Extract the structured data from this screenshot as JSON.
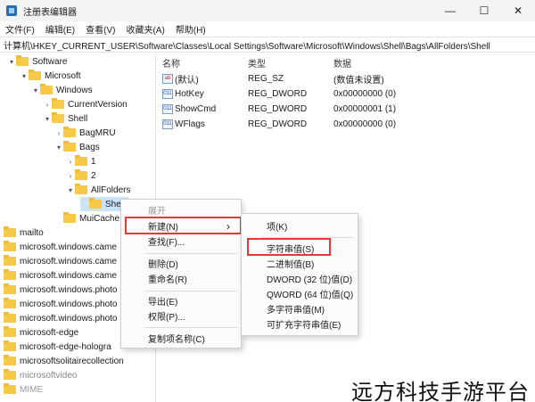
{
  "window": {
    "title": "注册表编辑器",
    "minimize": "—",
    "maximize": "☐",
    "close": "✕"
  },
  "menu": [
    "文件(F)",
    "编辑(E)",
    "查看(V)",
    "收藏夹(A)",
    "帮助(H)"
  ],
  "address": "计算机\\HKEY_CURRENT_USER\\Software\\Classes\\Local Settings\\Software\\Microsoft\\Windows\\Shell\\Bags\\AllFolders\\Shell",
  "tree": [
    {
      "label": "Software",
      "chevron": "▾"
    },
    {
      "label": "Microsoft",
      "chevron": "▾"
    },
    {
      "label": "Windows",
      "chevron": "▾"
    },
    {
      "label": "CurrentVersion",
      "chevron": "›"
    },
    {
      "label": "Shell",
      "chevron": "▾"
    },
    {
      "label": "BagMRU",
      "chevron": "›"
    },
    {
      "label": "Bags",
      "chevron": "▾"
    },
    {
      "label": "1",
      "chevron": "›"
    },
    {
      "label": "2",
      "chevron": "›"
    },
    {
      "label": "AllFolders",
      "chevron": "▾"
    },
    {
      "label": "Shell",
      "chevron": ""
    },
    {
      "label": "MuiCache",
      "chevron": ""
    },
    {
      "label": "mailto",
      "chevron": ""
    },
    {
      "label": "microsoft.windows.came",
      "chevron": ""
    },
    {
      "label": "microsoft.windows.came",
      "chevron": ""
    },
    {
      "label": "microsoft.windows.came",
      "chevron": ""
    },
    {
      "label": "microsoft.windows.photo",
      "chevron": ""
    },
    {
      "label": "microsoft.windows.photo",
      "chevron": ""
    },
    {
      "label": "microsoft.windows.photo",
      "chevron": ""
    },
    {
      "label": "microsoft-edge",
      "chevron": ""
    },
    {
      "label": "microsoft-edge-hologra",
      "chevron": ""
    },
    {
      "label": "microsoftsolitairecollection",
      "chevron": ""
    },
    {
      "label": "microsoftvideo",
      "chevron": ""
    },
    {
      "label": "MIME",
      "chevron": ""
    }
  ],
  "columns": {
    "name": "名称",
    "type": "类型",
    "data": "数据"
  },
  "values": [
    {
      "icon": "ab",
      "name": "(默认)",
      "type": "REG_SZ",
      "data": "(数值未设置)"
    },
    {
      "icon": "011",
      "name": "HotKey",
      "type": "REG_DWORD",
      "data": "0x00000000 (0)"
    },
    {
      "icon": "011",
      "name": "ShowCmd",
      "type": "REG_DWORD",
      "data": "0x00000001 (1)"
    },
    {
      "icon": "011",
      "name": "WFlags",
      "type": "REG_DWORD",
      "data": "0x00000000 (0)"
    }
  ],
  "context_menu": {
    "expand": "展开",
    "new": "新建(N)",
    "new_arrow": "›",
    "find": "查找(F)...",
    "delete": "删除(D)",
    "rename": "重命名(R)",
    "export": "导出(E)",
    "permissions": "权限(P)...",
    "copy_key_name": "复制项名称(C)"
  },
  "submenu": {
    "key": "项(K)",
    "string_value": "字符串值(S)",
    "binary_value": "二进制值(B)",
    "dword_value": "DWORD (32 位)值(D)",
    "qword_value": "QWORD (64 位)值(Q)",
    "multi_string_value": "多字符串值(M)",
    "expandable_string_value": "可扩充字符串值(E)"
  },
  "watermark": "远方科技手游平台",
  "colors": {
    "highlight_box": "#e53935",
    "selection": "#cce4f7",
    "folder": "#f7c948"
  }
}
